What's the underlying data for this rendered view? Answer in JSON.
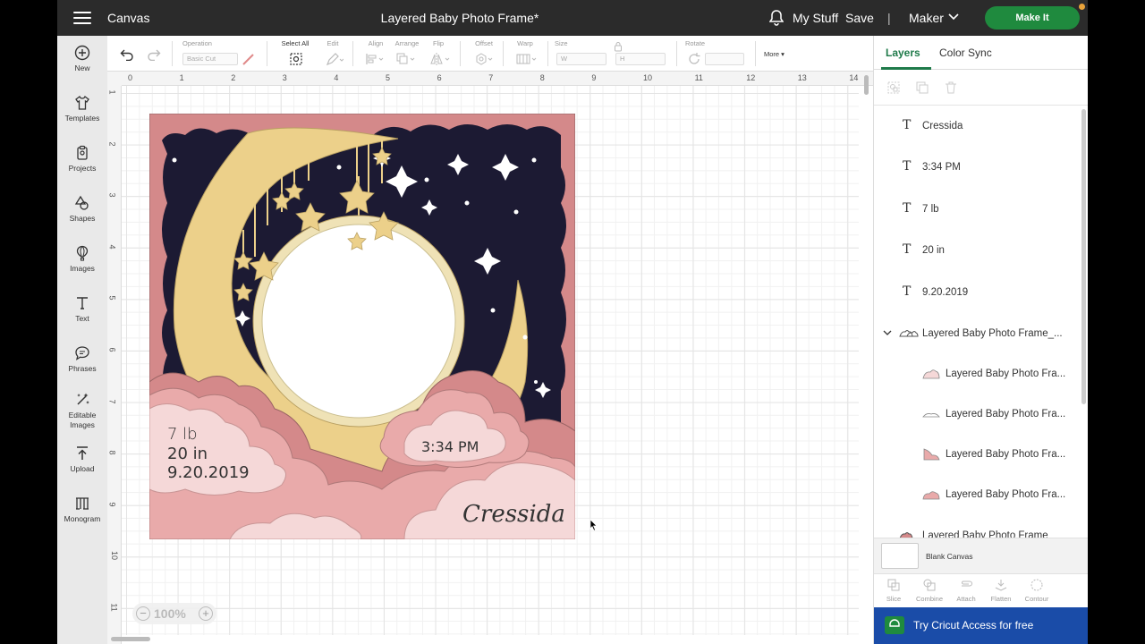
{
  "topbar": {
    "app_name": "Canvas",
    "doc_title": "Layered Baby Photo Frame*",
    "my_stuff": "My Stuff",
    "save": "Save",
    "separator": "|",
    "machine": "Maker",
    "make_it": "Make It"
  },
  "sidebar": {
    "items": [
      {
        "label": "New"
      },
      {
        "label": "Templates"
      },
      {
        "label": "Projects"
      },
      {
        "label": "Shapes"
      },
      {
        "label": "Images"
      },
      {
        "label": "Text"
      },
      {
        "label": "Phrases"
      },
      {
        "label": "Editable Images"
      },
      {
        "label": "Upload"
      },
      {
        "label": "Monogram"
      }
    ]
  },
  "toolbar": {
    "operation_label": "Operation",
    "operation_value": "Basic Cut",
    "select_all": "Select All",
    "edit": "Edit",
    "align": "Align",
    "arrange": "Arrange",
    "flip": "Flip",
    "offset": "Offset",
    "warp": "Warp",
    "size": "Size",
    "size_w": "W",
    "size_h": "H",
    "rotate": "Rotate",
    "more": "More ▾"
  },
  "ruler": {
    "h_marks": [
      "0",
      "1",
      "2",
      "3",
      "4",
      "5",
      "6",
      "7",
      "8",
      "9",
      "10",
      "11",
      "12",
      "13",
      "14"
    ],
    "v_marks": [
      "1",
      "2",
      "3",
      "4",
      "5",
      "6",
      "7",
      "8",
      "9",
      "10",
      "11"
    ]
  },
  "design": {
    "weight": "7 lb",
    "length": "20 in",
    "date": "9.20.2019",
    "time": "3:34 PM",
    "name": "Cressida"
  },
  "zoom": {
    "value": "100%",
    "minus": "−",
    "plus": "+"
  },
  "panel": {
    "tabs": [
      {
        "label": "Layers"
      },
      {
        "label": "Color Sync"
      }
    ],
    "layers": [
      {
        "name": "Cressida"
      },
      {
        "name": "3:34 PM"
      },
      {
        "name": "7 lb"
      },
      {
        "name": "20 in"
      },
      {
        "name": "9.20.2019"
      }
    ],
    "group": {
      "name": "Layered Baby Photo Frame_..."
    },
    "group_children": [
      {
        "name": "Layered Baby Photo Fra..."
      },
      {
        "name": "Layered Baby Photo Fra..."
      },
      {
        "name": "Layered Baby Photo Fra..."
      },
      {
        "name": "Layered Baby Photo Fra..."
      }
    ],
    "group2": {
      "name": "Layered Baby Photo Frame"
    },
    "blank_canvas": "Blank Canvas",
    "bottom_tools": [
      {
        "label": "Slice"
      },
      {
        "label": "Combine"
      },
      {
        "label": "Attach"
      },
      {
        "label": "Flatten"
      },
      {
        "label": "Contour"
      }
    ],
    "cricut_access": "Try Cricut Access for free"
  },
  "colors": {
    "topbar": "#2b2b2b",
    "make_it_green": "#1f8a3e",
    "access_blue": "#1a4ca8",
    "frame_rose": "#d4898a",
    "night_sky": "#1c1a33",
    "moon_yellow": "#ecd08a",
    "cloud_pink": "#e9aaaa",
    "cloud_light": "#f5d8d8"
  }
}
